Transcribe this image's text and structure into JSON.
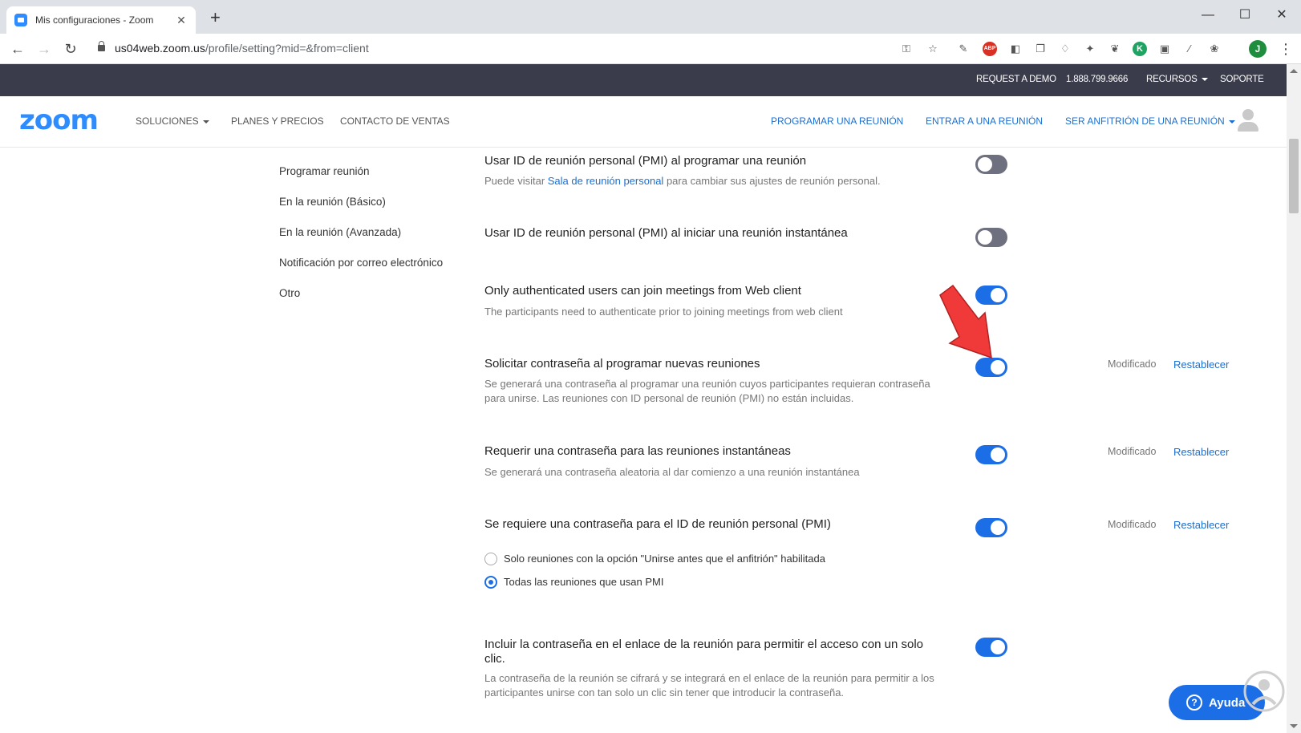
{
  "browser": {
    "tab_title": "Mis configuraciones - Zoom",
    "tab_close": "✕",
    "new_tab": "+",
    "url_domain": "us04web.zoom.us",
    "url_path": "/profile/setting?mid=&from=client",
    "profile_initial": "J",
    "window_controls": {
      "minimize": "—",
      "maximize": "☐",
      "close": "✕"
    }
  },
  "topbar": {
    "request_demo": "REQUEST A DEMO",
    "phone": "1.888.799.9666",
    "resources": "RECURSOS",
    "support": "SOPORTE"
  },
  "navbar": {
    "logo": "zoom",
    "solutions": "SOLUCIONES",
    "plans": "PLANES Y PRECIOS",
    "contact_sales": "CONTACTO DE VENTAS",
    "schedule": "PROGRAMAR UNA REUNIÓN",
    "join": "ENTRAR A UNA REUNIÓN",
    "host": "SER ANFITRIÓN DE UNA REUNIÓN"
  },
  "sidemenu": [
    "Programar reunión",
    "En la reunión (Básico)",
    "En la reunión (Avanzada)",
    "Notificación por correo electrónico",
    "Otro"
  ],
  "settings": {
    "pmi_schedule": {
      "title": "Usar ID de reunión personal (PMI) al programar una reunión",
      "desc_prefix": "Puede visitar ",
      "desc_link": "Sala de reunión personal",
      "desc_suffix": " para cambiar sus ajustes de reunión personal.",
      "enabled": false
    },
    "pmi_instant": {
      "title": "Usar ID de reunión personal (PMI) al iniciar una reunión instantánea",
      "enabled": false
    },
    "auth_web": {
      "title": "Only authenticated users can join meetings from Web client",
      "desc": "The participants need to authenticate prior to joining meetings from web client",
      "enabled": true
    },
    "password_schedule": {
      "title": "Solicitar contraseña al programar nuevas reuniones",
      "desc_line1": "Se generará una contraseña al programar una reunión cuyos participantes requieran contraseña",
      "desc_line2": "para unirse. Las reuniones con ID personal de reunión (PMI) no están incluidas.",
      "enabled": true,
      "modified": "Modificado",
      "reset": "Restablecer"
    },
    "password_instant": {
      "title": "Requerir una contraseña para las reuniones instantáneas",
      "desc": "Se generará una contraseña aleatoria al dar comienzo a una reunión instantánea",
      "enabled": true,
      "modified": "Modificado",
      "reset": "Restablecer"
    },
    "password_pmi": {
      "title": "Se requiere una contraseña para el ID de reunión personal (PMI)",
      "enabled": true,
      "modified": "Modificado",
      "reset": "Restablecer",
      "options": [
        {
          "label": "Solo reuniones con la opción \"Unirse antes que el anfitrión\" habilitada",
          "checked": false
        },
        {
          "label": "Todas las reuniones que usan PMI",
          "checked": true
        }
      ]
    },
    "embed_password": {
      "title_line1": "Incluir la contraseña en el enlace de la reunión para permitir el acceso con un solo",
      "title_line2": "clic.",
      "desc_line1": "La contraseña de la reunión se cifrará y se integrará en el enlace de la reunión para permitir a los",
      "desc_line2": "participantes unirse con tan solo un clic sin tener que introducir la contraseña.",
      "enabled": true
    }
  },
  "help": {
    "label": "Ayuda",
    "icon": "?"
  },
  "colors": {
    "accent": "#1c6ee6",
    "link": "#1a6fd1",
    "topbar": "#3a3c4b",
    "annotation_arrow": "#f03a3a"
  }
}
